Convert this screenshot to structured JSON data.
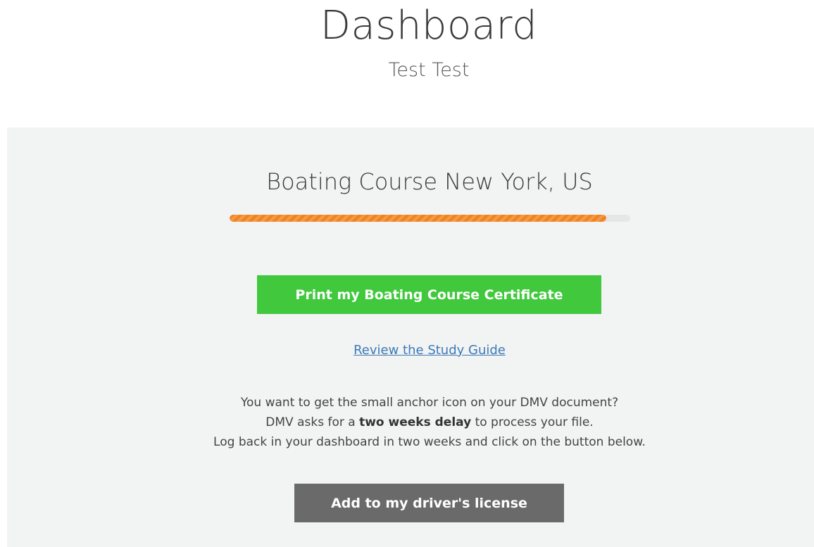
{
  "header": {
    "title": "Dashboard",
    "user_name": "Test Test"
  },
  "course": {
    "title": "Boating Course New York, US",
    "progress_percent": 94
  },
  "actions": {
    "print_certificate_label": "Print my Boating Course Certificate",
    "study_guide_link": "Review the Study Guide",
    "add_license_label": "Add to my driver's license"
  },
  "info": {
    "line1": "You want to get the small anchor icon on your DMV document?",
    "line2_prefix": "DMV asks for a ",
    "line2_bold": "two weeks delay",
    "line2_suffix": " to process your file.",
    "line3": "Log back in your dashboard in two weeks and click on the button below."
  },
  "colors": {
    "progress_fill": "#f1831d",
    "progress_track": "#e6e6e6",
    "print_button": "#41c83d",
    "license_button": "#6a6a6a",
    "link": "#3d7ab8",
    "panel_background": "#f2f3f3"
  }
}
